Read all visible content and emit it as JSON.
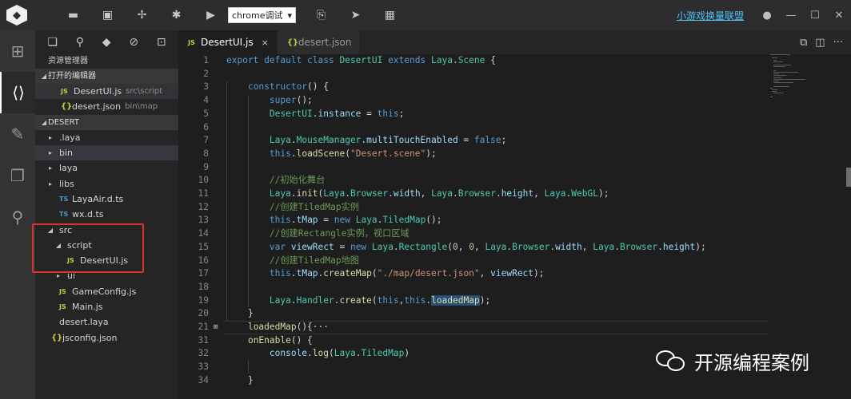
{
  "topbar": {
    "logo_icon": "laya-logo-icon",
    "icons": [
      "folder-icon",
      "save-icon",
      "debug-pin-icon",
      "bug-icon",
      "play-icon"
    ],
    "run_target": "chrome调试",
    "icons_after": [
      "export-icon",
      "publish-icon",
      "qrcode-icon"
    ],
    "league_link": "小游戏换量联盟",
    "window_buttons": [
      "user-icon",
      "minimize-icon",
      "maximize-icon",
      "close-icon"
    ]
  },
  "activity": [
    "layout-grid-icon",
    "code-editor-icon",
    "palette-icon",
    "chat-icon",
    "search-icon"
  ],
  "sidebar": {
    "toolbar": [
      "new-file-icon",
      "search-icon",
      "git-icon",
      "debug-icon",
      "extensions-icon"
    ],
    "title": "资源管理器",
    "open_editors": {
      "header": "打开的编辑器",
      "items": [
        {
          "icon": "JS",
          "name": "DesertUI.js",
          "path": "src\\script"
        },
        {
          "icon": "{}",
          "name": "desert.json",
          "path": "bin\\map"
        }
      ]
    },
    "project": {
      "header": "DESERT",
      "items": [
        {
          "depth": 1,
          "arrow": "▸",
          "icon": "",
          "name": ".laya"
        },
        {
          "depth": 1,
          "arrow": "▸",
          "icon": "",
          "name": "bin"
        },
        {
          "depth": 1,
          "arrow": "▸",
          "icon": "",
          "name": "laya"
        },
        {
          "depth": 1,
          "arrow": "▸",
          "icon": "",
          "name": "libs"
        },
        {
          "depth": 2,
          "arrow": "",
          "icon": "TS",
          "name": "LayaAir.d.ts"
        },
        {
          "depth": 2,
          "arrow": "",
          "icon": "TS",
          "name": "wx.d.ts"
        },
        {
          "depth": 1,
          "arrow": "◢",
          "icon": "",
          "name": "src"
        },
        {
          "depth": 2,
          "arrow": "◢",
          "icon": "",
          "name": "script"
        },
        {
          "depth": 3,
          "arrow": "",
          "icon": "JS",
          "name": "DesertUI.js"
        },
        {
          "depth": 2,
          "arrow": "▸",
          "icon": "",
          "name": "ui"
        },
        {
          "depth": 2,
          "arrow": "",
          "icon": "JS",
          "name": "GameConfig.js"
        },
        {
          "depth": 2,
          "arrow": "",
          "icon": "JS",
          "name": "Main.js"
        },
        {
          "depth": 1,
          "arrow": "",
          "icon": "",
          "name": "desert.laya"
        },
        {
          "depth": 1,
          "arrow": "",
          "icon": "{}",
          "name": "jsconfig.json"
        }
      ]
    }
  },
  "tabs": [
    {
      "icon": "JS",
      "label": "DesertUI.js",
      "close": "×",
      "active": true
    },
    {
      "icon": "{}",
      "label": "desert.json",
      "close": "",
      "active": false
    }
  ],
  "tab_actions": [
    "open-changes-icon",
    "split-editor-icon",
    "more-icon"
  ],
  "code": [
    {
      "n": "1",
      "fold": "",
      "tokens": [
        [
          "kw",
          "export "
        ],
        [
          "kw",
          "default "
        ],
        [
          "kw",
          "class "
        ],
        [
          "cls",
          "DesertUI "
        ],
        [
          "kw",
          "extends "
        ],
        [
          "cls",
          "Laya"
        ],
        [
          "pl",
          "."
        ],
        [
          "cls",
          "Scene"
        ],
        [
          "pl",
          " {"
        ]
      ]
    },
    {
      "n": "2",
      "fold": "",
      "tokens": []
    },
    {
      "n": "3",
      "fold": "",
      "tokens": [
        [
          "pl",
          "    "
        ],
        [
          "kw",
          "constructor"
        ],
        [
          "pl",
          "() {"
        ]
      ]
    },
    {
      "n": "4",
      "fold": "",
      "tokens": [
        [
          "pl",
          "        "
        ],
        [
          "kw",
          "super"
        ],
        [
          "pl",
          "();"
        ]
      ]
    },
    {
      "n": "5",
      "fold": "",
      "tokens": [
        [
          "pl",
          "        "
        ],
        [
          "cls",
          "DesertUI"
        ],
        [
          "pl",
          "."
        ],
        [
          "var",
          "instance"
        ],
        [
          "pl",
          " = "
        ],
        [
          "kw",
          "this"
        ],
        [
          "pl",
          ";"
        ]
      ]
    },
    {
      "n": "6",
      "fold": "",
      "tokens": []
    },
    {
      "n": "7",
      "fold": "",
      "tokens": [
        [
          "pl",
          "        "
        ],
        [
          "cls",
          "Laya"
        ],
        [
          "pl",
          "."
        ],
        [
          "cls",
          "MouseManager"
        ],
        [
          "pl",
          "."
        ],
        [
          "var",
          "multiTouchEnabled"
        ],
        [
          "pl",
          " = "
        ],
        [
          "kw",
          "false"
        ],
        [
          "pl",
          ";"
        ]
      ]
    },
    {
      "n": "8",
      "fold": "",
      "tokens": [
        [
          "pl",
          "        "
        ],
        [
          "kw",
          "this"
        ],
        [
          "pl",
          "."
        ],
        [
          "fn",
          "loadScene"
        ],
        [
          "pl",
          "("
        ],
        [
          "str",
          "\"Desert.scene\""
        ],
        [
          "pl",
          ");"
        ]
      ]
    },
    {
      "n": "9",
      "fold": "",
      "tokens": []
    },
    {
      "n": "10",
      "fold": "",
      "tokens": [
        [
          "pl",
          "        "
        ],
        [
          "cmt",
          "//初始化舞台"
        ]
      ]
    },
    {
      "n": "11",
      "fold": "",
      "tokens": [
        [
          "pl",
          "        "
        ],
        [
          "cls",
          "Laya"
        ],
        [
          "pl",
          "."
        ],
        [
          "fn",
          "init"
        ],
        [
          "pl",
          "("
        ],
        [
          "cls",
          "Laya"
        ],
        [
          "pl",
          "."
        ],
        [
          "cls",
          "Browser"
        ],
        [
          "pl",
          "."
        ],
        [
          "var",
          "width"
        ],
        [
          "pl",
          ", "
        ],
        [
          "cls",
          "Laya"
        ],
        [
          "pl",
          "."
        ],
        [
          "cls",
          "Browser"
        ],
        [
          "pl",
          "."
        ],
        [
          "var",
          "height"
        ],
        [
          "pl",
          ", "
        ],
        [
          "cls",
          "Laya"
        ],
        [
          "pl",
          "."
        ],
        [
          "cls",
          "WebGL"
        ],
        [
          "pl",
          ");"
        ]
      ]
    },
    {
      "n": "12",
      "fold": "",
      "tokens": [
        [
          "pl",
          "        "
        ],
        [
          "cmt",
          "//创建TiledMap实例"
        ]
      ]
    },
    {
      "n": "13",
      "fold": "",
      "tokens": [
        [
          "pl",
          "        "
        ],
        [
          "kw",
          "this"
        ],
        [
          "pl",
          "."
        ],
        [
          "var",
          "tMap"
        ],
        [
          "pl",
          " = "
        ],
        [
          "kw",
          "new "
        ],
        [
          "cls",
          "Laya"
        ],
        [
          "pl",
          "."
        ],
        [
          "cls",
          "TiledMap"
        ],
        [
          "pl",
          "();"
        ]
      ]
    },
    {
      "n": "14",
      "fold": "",
      "tokens": [
        [
          "pl",
          "        "
        ],
        [
          "cmt",
          "//创建Rectangle实例，视口区域"
        ]
      ]
    },
    {
      "n": "15",
      "fold": "",
      "tokens": [
        [
          "pl",
          "        "
        ],
        [
          "kw",
          "var "
        ],
        [
          "var",
          "viewRect"
        ],
        [
          "pl",
          " = "
        ],
        [
          "kw",
          "new "
        ],
        [
          "cls",
          "Laya"
        ],
        [
          "pl",
          "."
        ],
        [
          "cls",
          "Rectangle"
        ],
        [
          "pl",
          "("
        ],
        [
          "num",
          "0"
        ],
        [
          "pl",
          ", "
        ],
        [
          "num",
          "0"
        ],
        [
          "pl",
          ", "
        ],
        [
          "cls",
          "Laya"
        ],
        [
          "pl",
          "."
        ],
        [
          "cls",
          "Browser"
        ],
        [
          "pl",
          "."
        ],
        [
          "var",
          "width"
        ],
        [
          "pl",
          ", "
        ],
        [
          "cls",
          "Laya"
        ],
        [
          "pl",
          "."
        ],
        [
          "cls",
          "Browser"
        ],
        [
          "pl",
          "."
        ],
        [
          "var",
          "height"
        ],
        [
          "pl",
          ");"
        ]
      ]
    },
    {
      "n": "16",
      "fold": "",
      "tokens": [
        [
          "pl",
          "        "
        ],
        [
          "cmt",
          "//创建TiledMap地图"
        ]
      ]
    },
    {
      "n": "17",
      "fold": "",
      "tokens": [
        [
          "pl",
          "        "
        ],
        [
          "kw",
          "this"
        ],
        [
          "pl",
          "."
        ],
        [
          "var",
          "tMap"
        ],
        [
          "pl",
          "."
        ],
        [
          "fn",
          "createMap"
        ],
        [
          "pl",
          "("
        ],
        [
          "str",
          "\"./map/desert.json\""
        ],
        [
          "pl",
          ", "
        ],
        [
          "var",
          "viewRect"
        ],
        [
          "pl",
          ");"
        ]
      ]
    },
    {
      "n": "18",
      "fold": "",
      "tokens": []
    },
    {
      "n": "19",
      "fold": "",
      "tokens": [
        [
          "pl",
          "        "
        ],
        [
          "cls",
          "Laya"
        ],
        [
          "pl",
          "."
        ],
        [
          "cls",
          "Handler"
        ],
        [
          "pl",
          "."
        ],
        [
          "fn",
          "create"
        ],
        [
          "pl",
          "("
        ],
        [
          "kw",
          "this"
        ],
        [
          "pl",
          ","
        ],
        [
          "kw",
          "this"
        ],
        [
          "pl",
          "."
        ],
        [
          "hl",
          "loadedMap"
        ],
        [
          "pl",
          ");"
        ]
      ]
    },
    {
      "n": "20",
      "fold": "",
      "tokens": [
        [
          "pl",
          "    }"
        ]
      ]
    },
    {
      "n": "21",
      "fold": "⊞",
      "tokens": [
        [
          "pl",
          "    "
        ],
        [
          "fn",
          "loadedMap"
        ],
        [
          "pl",
          "(){"
        ],
        [
          "pl",
          "···"
        ]
      ]
    },
    {
      "n": "31",
      "fold": "",
      "tokens": [
        [
          "pl",
          "    "
        ],
        [
          "fn",
          "onEnable"
        ],
        [
          "pl",
          "() {"
        ]
      ]
    },
    {
      "n": "32",
      "fold": "",
      "tokens": [
        [
          "pl",
          "        "
        ],
        [
          "var",
          "console"
        ],
        [
          "pl",
          "."
        ],
        [
          "fn",
          "log"
        ],
        [
          "pl",
          "("
        ],
        [
          "cls",
          "Laya"
        ],
        [
          "pl",
          "."
        ],
        [
          "cls",
          "TiledMap"
        ],
        [
          "pl",
          ")"
        ]
      ]
    },
    {
      "n": "33",
      "fold": "",
      "tokens": []
    },
    {
      "n": "34",
      "fold": "",
      "tokens": [
        [
          "pl",
          "    }"
        ]
      ]
    }
  ],
  "watermark": {
    "icon": "wechat-icon",
    "text": "开源编程案例"
  }
}
